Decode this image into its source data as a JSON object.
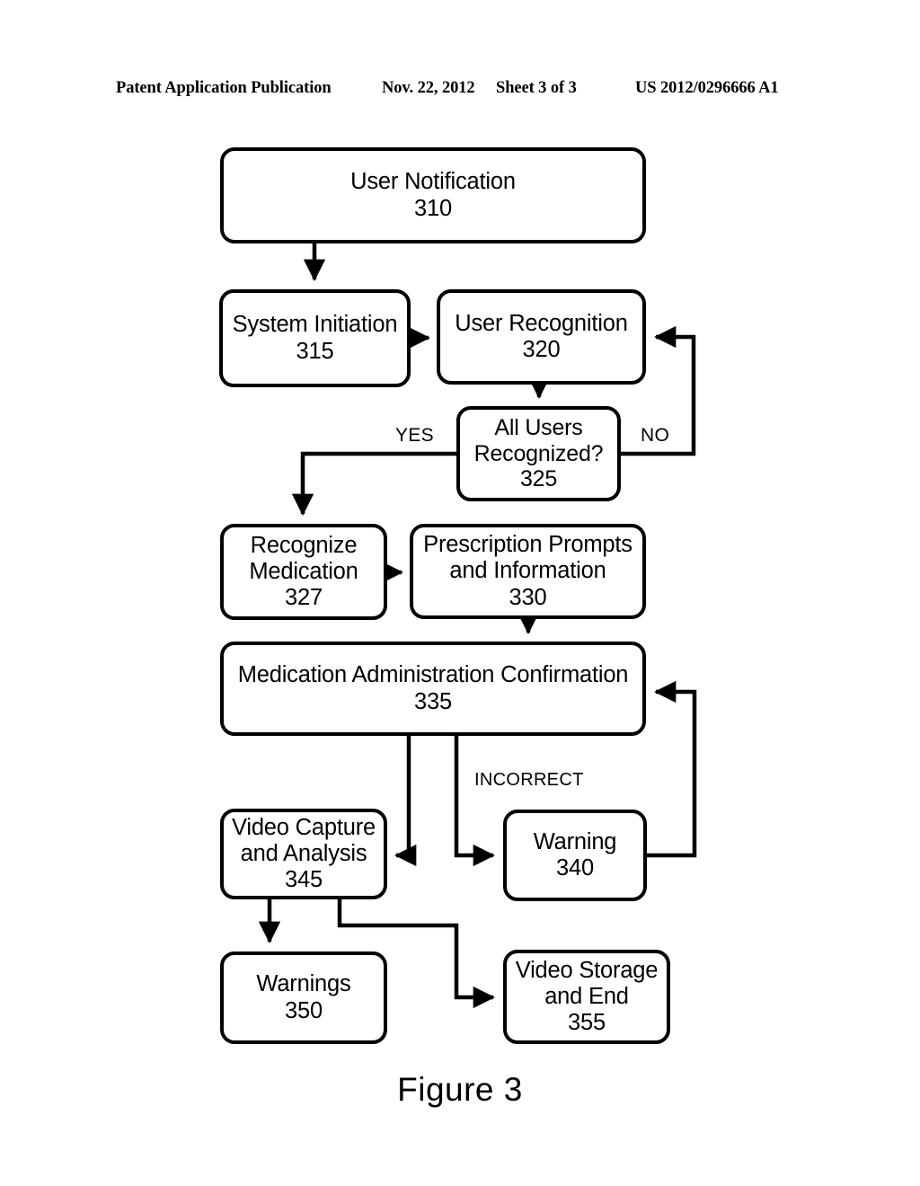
{
  "header": {
    "publication": "Patent Application Publication",
    "date": "Nov. 22, 2012",
    "sheet": "Sheet 3 of 3",
    "number": "US 2012/0296666 A1"
  },
  "figure": {
    "caption": "Figure 3",
    "stroke_color": "#000000",
    "background_color": "#ffffff",
    "nodes": [
      {
        "id": "310",
        "label": "User Notification",
        "number": "310"
      },
      {
        "id": "315",
        "label": "System Initiation",
        "number": "315"
      },
      {
        "id": "320",
        "label": "User Recognition",
        "number": "320"
      },
      {
        "id": "325",
        "label": "All Users\nRecognized?",
        "number": "325"
      },
      {
        "id": "327",
        "label": "Recognize\nMedication",
        "number": "327"
      },
      {
        "id": "330",
        "label": "Prescription Prompts\nand Information",
        "number": "330"
      },
      {
        "id": "335",
        "label": "Medication Administration Confirmation",
        "number": "335"
      },
      {
        "id": "340",
        "label": "Warning",
        "number": "340"
      },
      {
        "id": "345",
        "label": "Video Capture\nand Analysis",
        "number": "345"
      },
      {
        "id": "350",
        "label": "Warnings",
        "number": "350"
      },
      {
        "id": "355",
        "label": "Video Storage\nand End",
        "number": "355"
      }
    ],
    "edge_labels": {
      "yes": "YES",
      "no": "NO",
      "incorrect": "INCORRECT"
    }
  }
}
